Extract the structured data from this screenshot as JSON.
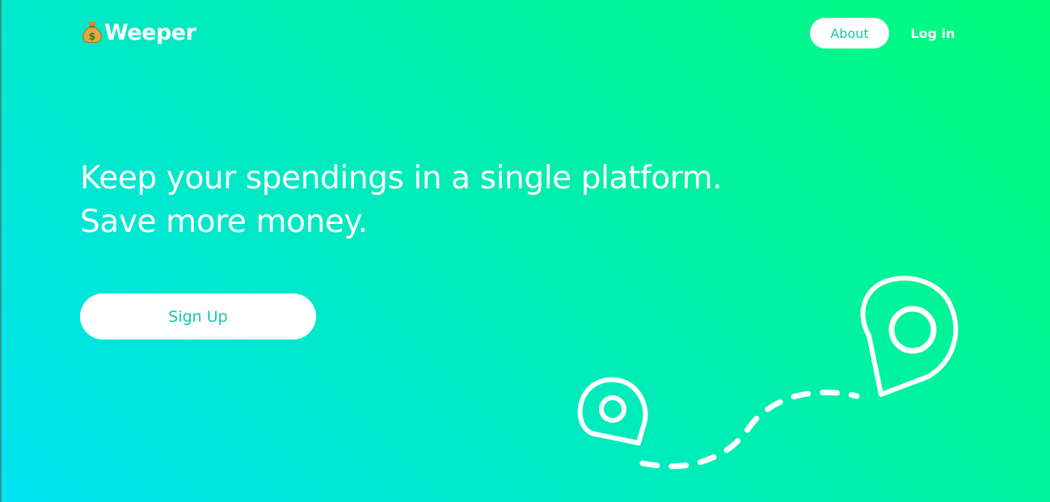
{
  "brand": {
    "name": "Weeper",
    "icon": "money-bag-icon"
  },
  "nav": {
    "about_label": "About",
    "login_label": "Log in"
  },
  "hero": {
    "line1": "Keep your spendings in a single platform.",
    "line2": "Save more money."
  },
  "cta": {
    "signup_label": "Sign Up"
  },
  "illustration": {
    "icons": [
      "map-pin-icon",
      "map-pin-icon",
      "dashed-route"
    ]
  },
  "colors": {
    "gradient_start": "#00e2f0",
    "gradient_end": "#00fb78",
    "accent_text": "#13c8a4",
    "white": "#ffffff"
  }
}
